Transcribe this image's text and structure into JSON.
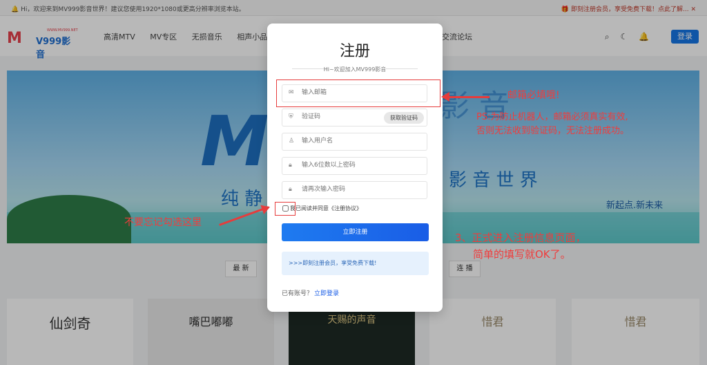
{
  "topbar": {
    "greeting": "Hi，欢迎来到MV999影音世界！建议您使用1920*1080或更高分辨率浏览本站。",
    "notice": "即刻注册会员，享受免费下载！点此了解..."
  },
  "nav": {
    "logo": {
      "mark": "M",
      "text": "V999影音",
      "tiny": "WWW.MV999.NET"
    },
    "menu": [
      "高清MTV",
      "MV专区",
      "无损音乐",
      "相声小品",
      "交流论坛"
    ],
    "login_label": "登录",
    "icons": [
      "search-icon",
      "moon-icon",
      "bell-icon"
    ]
  },
  "banner": {
    "big_letter": "M",
    "headline_left": "纯 静",
    "headline_right": "影 音 世 界",
    "faded_title": "影 音",
    "slogan": "新起点.新未来"
  },
  "tabs": {
    "first": "最 新",
    "last": "连 播"
  },
  "cards": [
    "仙剑奇",
    "嘴巴嘟嘟",
    "",
    "天赐的声音",
    "",
    "惜君",
    "惜君"
  ],
  "modal": {
    "title": "注册",
    "subtitle": "Hi~欢迎加入MV999影音",
    "fields": {
      "email": {
        "placeholder": "输入邮箱",
        "value": ""
      },
      "code": {
        "placeholder": "验证码",
        "value": ""
      },
      "username": {
        "placeholder": "输入用户名",
        "value": ""
      },
      "password": {
        "placeholder": "输入6位数以上密码",
        "value": ""
      },
      "password_confirm": {
        "placeholder": "请再次输入密码",
        "value": ""
      }
    },
    "get_code_label": "获取验证码",
    "agree_text": "我已阅读并同意《注册协议》",
    "agree_checked": false,
    "submit_label": "立即注册",
    "promo_text": ">>>即刻注册会员，享受免费下载!",
    "has_account_text": "已有账号？",
    "login_link": "立即登录"
  },
  "annotations": {
    "email_required": "邮箱必填哦!",
    "email_warning_1": "PS:为防止机器人，邮箱必须真实有效,",
    "email_warning_2": "否则无法收到验证码，无法注册成功。",
    "checkbox_reminder": "不要忘记勾选这里",
    "step_1": "3、正式进入注册信息页面，",
    "step_2": "简单的填写就OK了。",
    "color": "#e63c3c"
  }
}
